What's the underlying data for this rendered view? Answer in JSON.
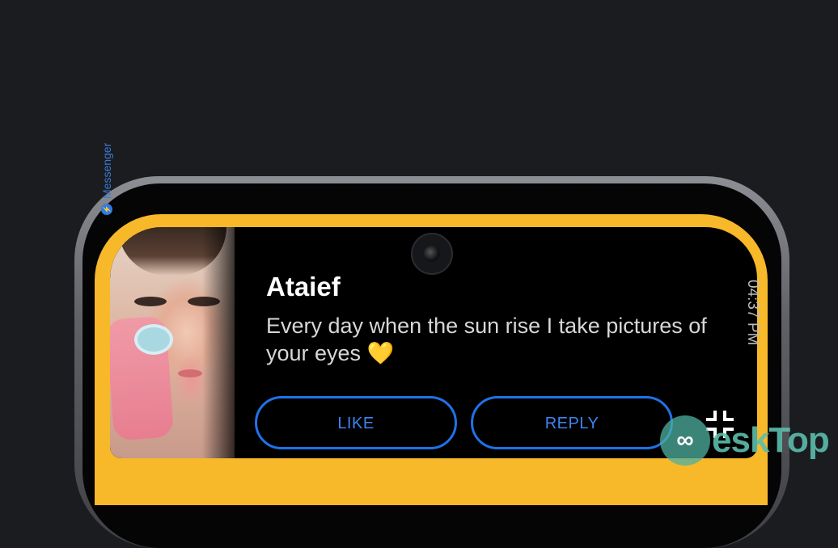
{
  "notification": {
    "sender": "Ataief",
    "message": "Every day when the sun rise I take pictures of your eyes",
    "emoji": "💛",
    "time": "04:37 PM",
    "app": "Messenger",
    "actions": {
      "like_label": "LIKE",
      "reply_label": "REPLY"
    }
  },
  "icons": {
    "collapse": "collapse-icon",
    "camera": "front-camera-icon",
    "messenger": "messenger-icon"
  },
  "watermark": {
    "logo_glyph": "∞",
    "text": "eskTop"
  },
  "colors": {
    "background": "#1b1c20",
    "screen_accent": "#f7b82a",
    "button_outline": "#1f72e8",
    "button_text": "#3c84ee"
  }
}
